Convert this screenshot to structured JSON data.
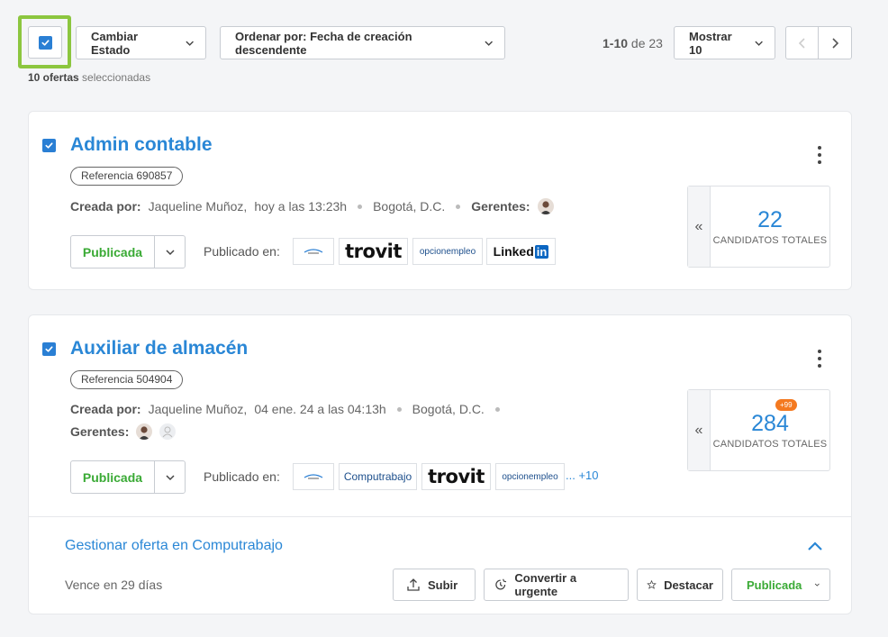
{
  "toolbar": {
    "change_status_label": "Cambiar Estado",
    "sort_label": "Ordenar por: Fecha de creación descendente",
    "range": "1-10",
    "range_of": "de 23",
    "show_label": "Mostrar 10",
    "selected_count": "10 ofertas",
    "selected_suffix": "seleccionadas"
  },
  "offers": [
    {
      "title": "Admin contable",
      "reference": "Referencia 690857",
      "created_by_label": "Creada por:",
      "creator": "Jaqueline Muñoz,",
      "created_at": "hoy a las 13:23h",
      "location": "Bogotá, D.C.",
      "managers_label": "Gerentes:",
      "status": "Publicada",
      "published_on_label": "Publicado en:",
      "portals": [
        "",
        "trovit",
        "opcionempleo",
        "Linked",
        "in"
      ],
      "candidates": "22",
      "candidates_label": "CANDIDATOS TOTALES"
    },
    {
      "title": "Auxiliar de almacén",
      "reference": "Referencia 504904",
      "created_by_label": "Creada por:",
      "creator": "Jaqueline Muñoz,",
      "created_at": "04 ene. 24 a las 04:13h",
      "location": "Bogotá, D.C.",
      "managers_label": "Gerentes:",
      "status": "Publicada",
      "published_on_label": "Publicado en:",
      "portals": [
        "",
        "Computrabajo",
        "trovit",
        "opcionempleo"
      ],
      "more_portals": "... +10",
      "candidates": "284",
      "candidates_badge": "+99",
      "candidates_label": "CANDIDATOS TOTALES",
      "manage": {
        "title": "Gestionar oferta en Computrabajo",
        "expires": "Vence en 29 días",
        "upload": "Subir",
        "urgent": "Convertir a urgente",
        "highlight": "Destacar",
        "status": "Publicada"
      }
    }
  ],
  "colors": {
    "accent": "#2a87d6",
    "published": "#3aaa35",
    "highlight_frame": "#8cc63f",
    "badge": "#f47920"
  }
}
